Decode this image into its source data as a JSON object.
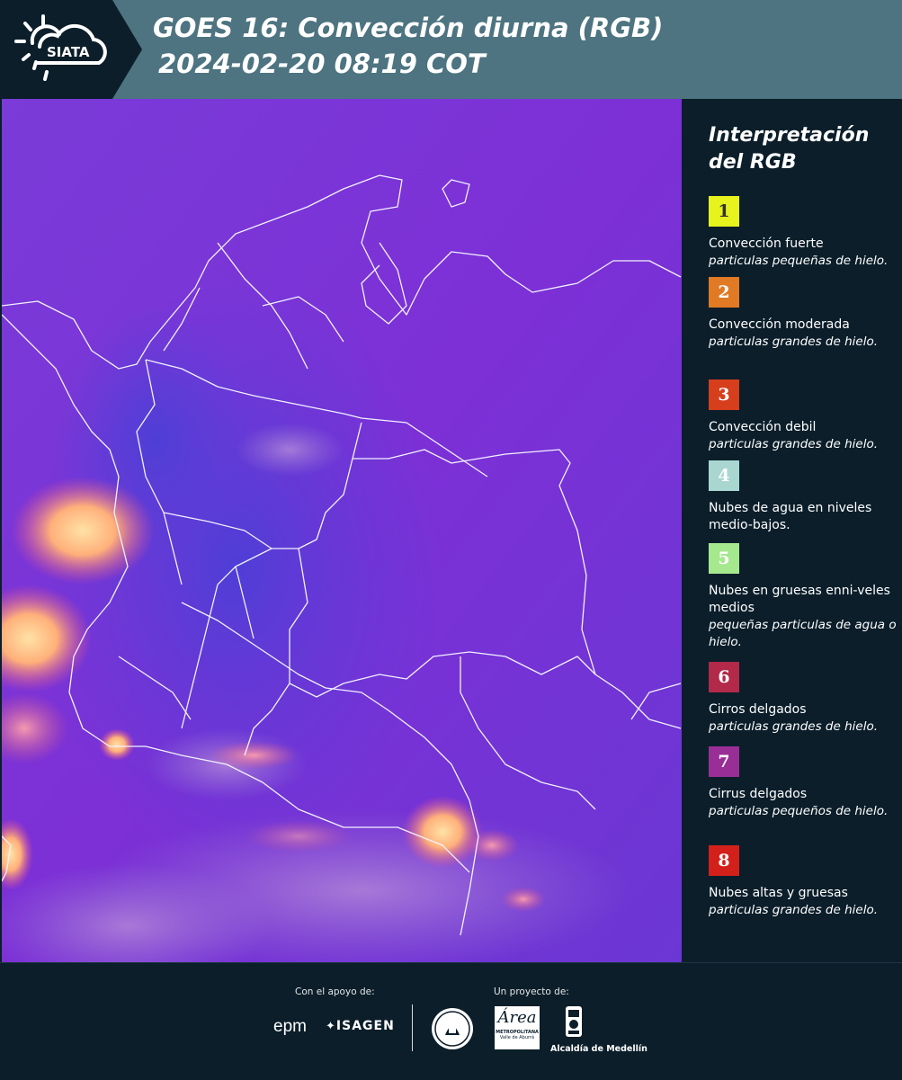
{
  "header": {
    "logo_text": "SIATA",
    "title_line1": "GOES 16: Convección diurna (RGB)",
    "title_line2": "2024-02-20 08:19 COT"
  },
  "legend": {
    "title": "Interpretación del RGB",
    "items": [
      {
        "number": "1",
        "color": "#e8f21c",
        "num_color": "#333333",
        "name": "Convección fuerte",
        "desc": "particulas pequeñas de hielo."
      },
      {
        "number": "2",
        "color": "#e07a24",
        "num_color": "#ffffff",
        "name": "Convección moderada",
        "desc": "particulas grandes de hielo."
      },
      {
        "number": "3",
        "color": "#d63e1c",
        "num_color": "#ffffff",
        "name": "Convección debil",
        "desc": "particulas grandes de hielo."
      },
      {
        "number": "4",
        "color": "#a9d6d1",
        "num_color": "#ffffff",
        "name": "Nubes de agua en niveles medio-bajos.",
        "desc": ""
      },
      {
        "number": "5",
        "color": "#a6e88e",
        "num_color": "#ffffff",
        "name": "Nubes en gruesas enni-veles medios",
        "desc": "pequeñas particulas de agua o hielo."
      },
      {
        "number": "6",
        "color": "#b2294a",
        "num_color": "#ffffff",
        "name": "Cirros delgados",
        "desc": "particulas grandes de hielo."
      },
      {
        "number": "7",
        "color": "#9a2e97",
        "num_color": "#ffffff",
        "name": "Cirrus delgados",
        "desc": "particulas pequeños de hielo."
      },
      {
        "number": "8",
        "color": "#d4201a",
        "num_color": "#ffffff",
        "name": "Nubes altas y gruesas",
        "desc": "particulas grandes de hielo."
      }
    ]
  },
  "footer": {
    "support_label": "Con el apoyo de:",
    "project_label": "Un proyecto de:",
    "sponsor_1": "epm",
    "sponsor_2": "ISAGEN",
    "amva_name": "Área",
    "amva_caption": "METROPOLITANA",
    "amva_sub": "Valle de Aburrá",
    "alcaldia": "Alcaldía de Medellín"
  }
}
